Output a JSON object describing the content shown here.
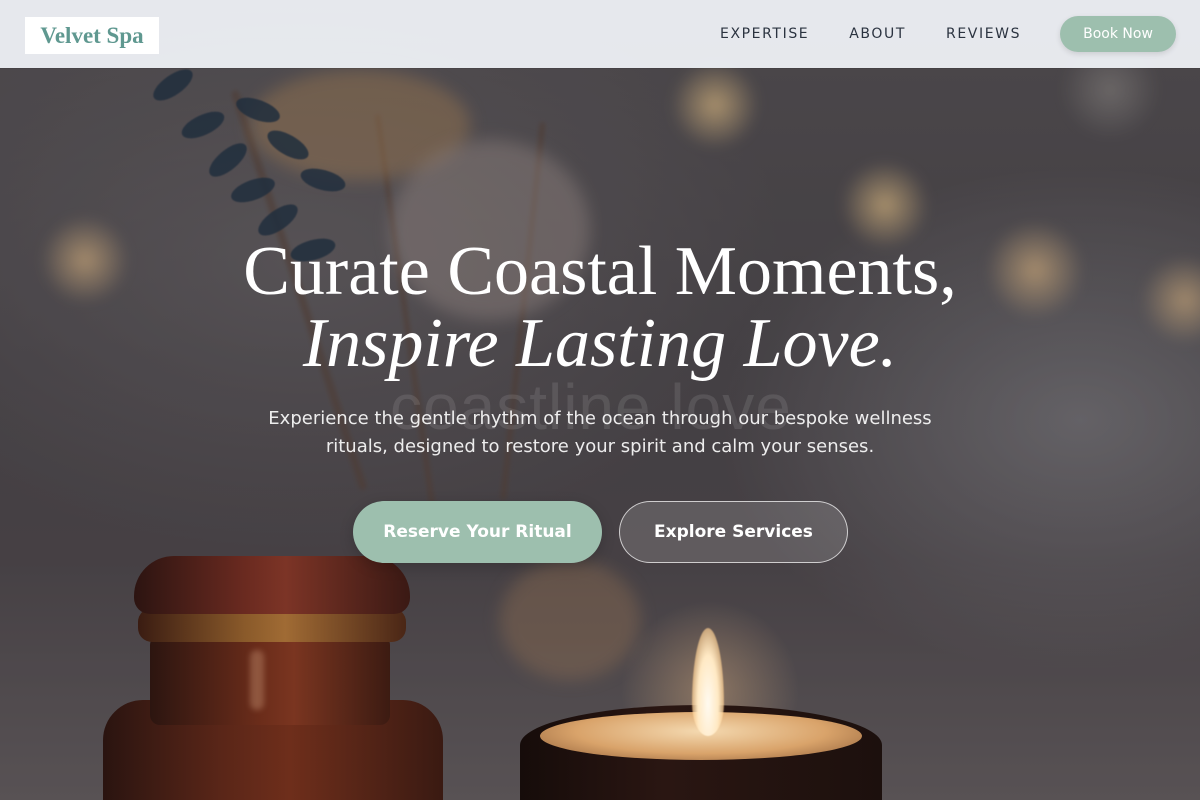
{
  "brand": {
    "name": "Velvet Spa"
  },
  "nav": {
    "items": [
      {
        "label": "EXPERTISE"
      },
      {
        "label": "ABOUT"
      },
      {
        "label": "REVIEWS"
      }
    ],
    "cta_label": "Book Now"
  },
  "hero": {
    "headline_line1": "Curate Coastal Moments,",
    "headline_line2": "Inspire Lasting Love.",
    "subtitle": "Experience the gentle rhythm of the ocean through our bespoke wellness rituals, designed to restore your spirit and calm your senses.",
    "primary_cta": "Reserve Your Ritual",
    "secondary_cta": "Explore Services",
    "background_text": "coastline love"
  },
  "colors": {
    "accent": "#9dbfae",
    "brand_text": "#5f9890",
    "header_bg": "#eef1f6",
    "nav_text": "#2b3340"
  }
}
